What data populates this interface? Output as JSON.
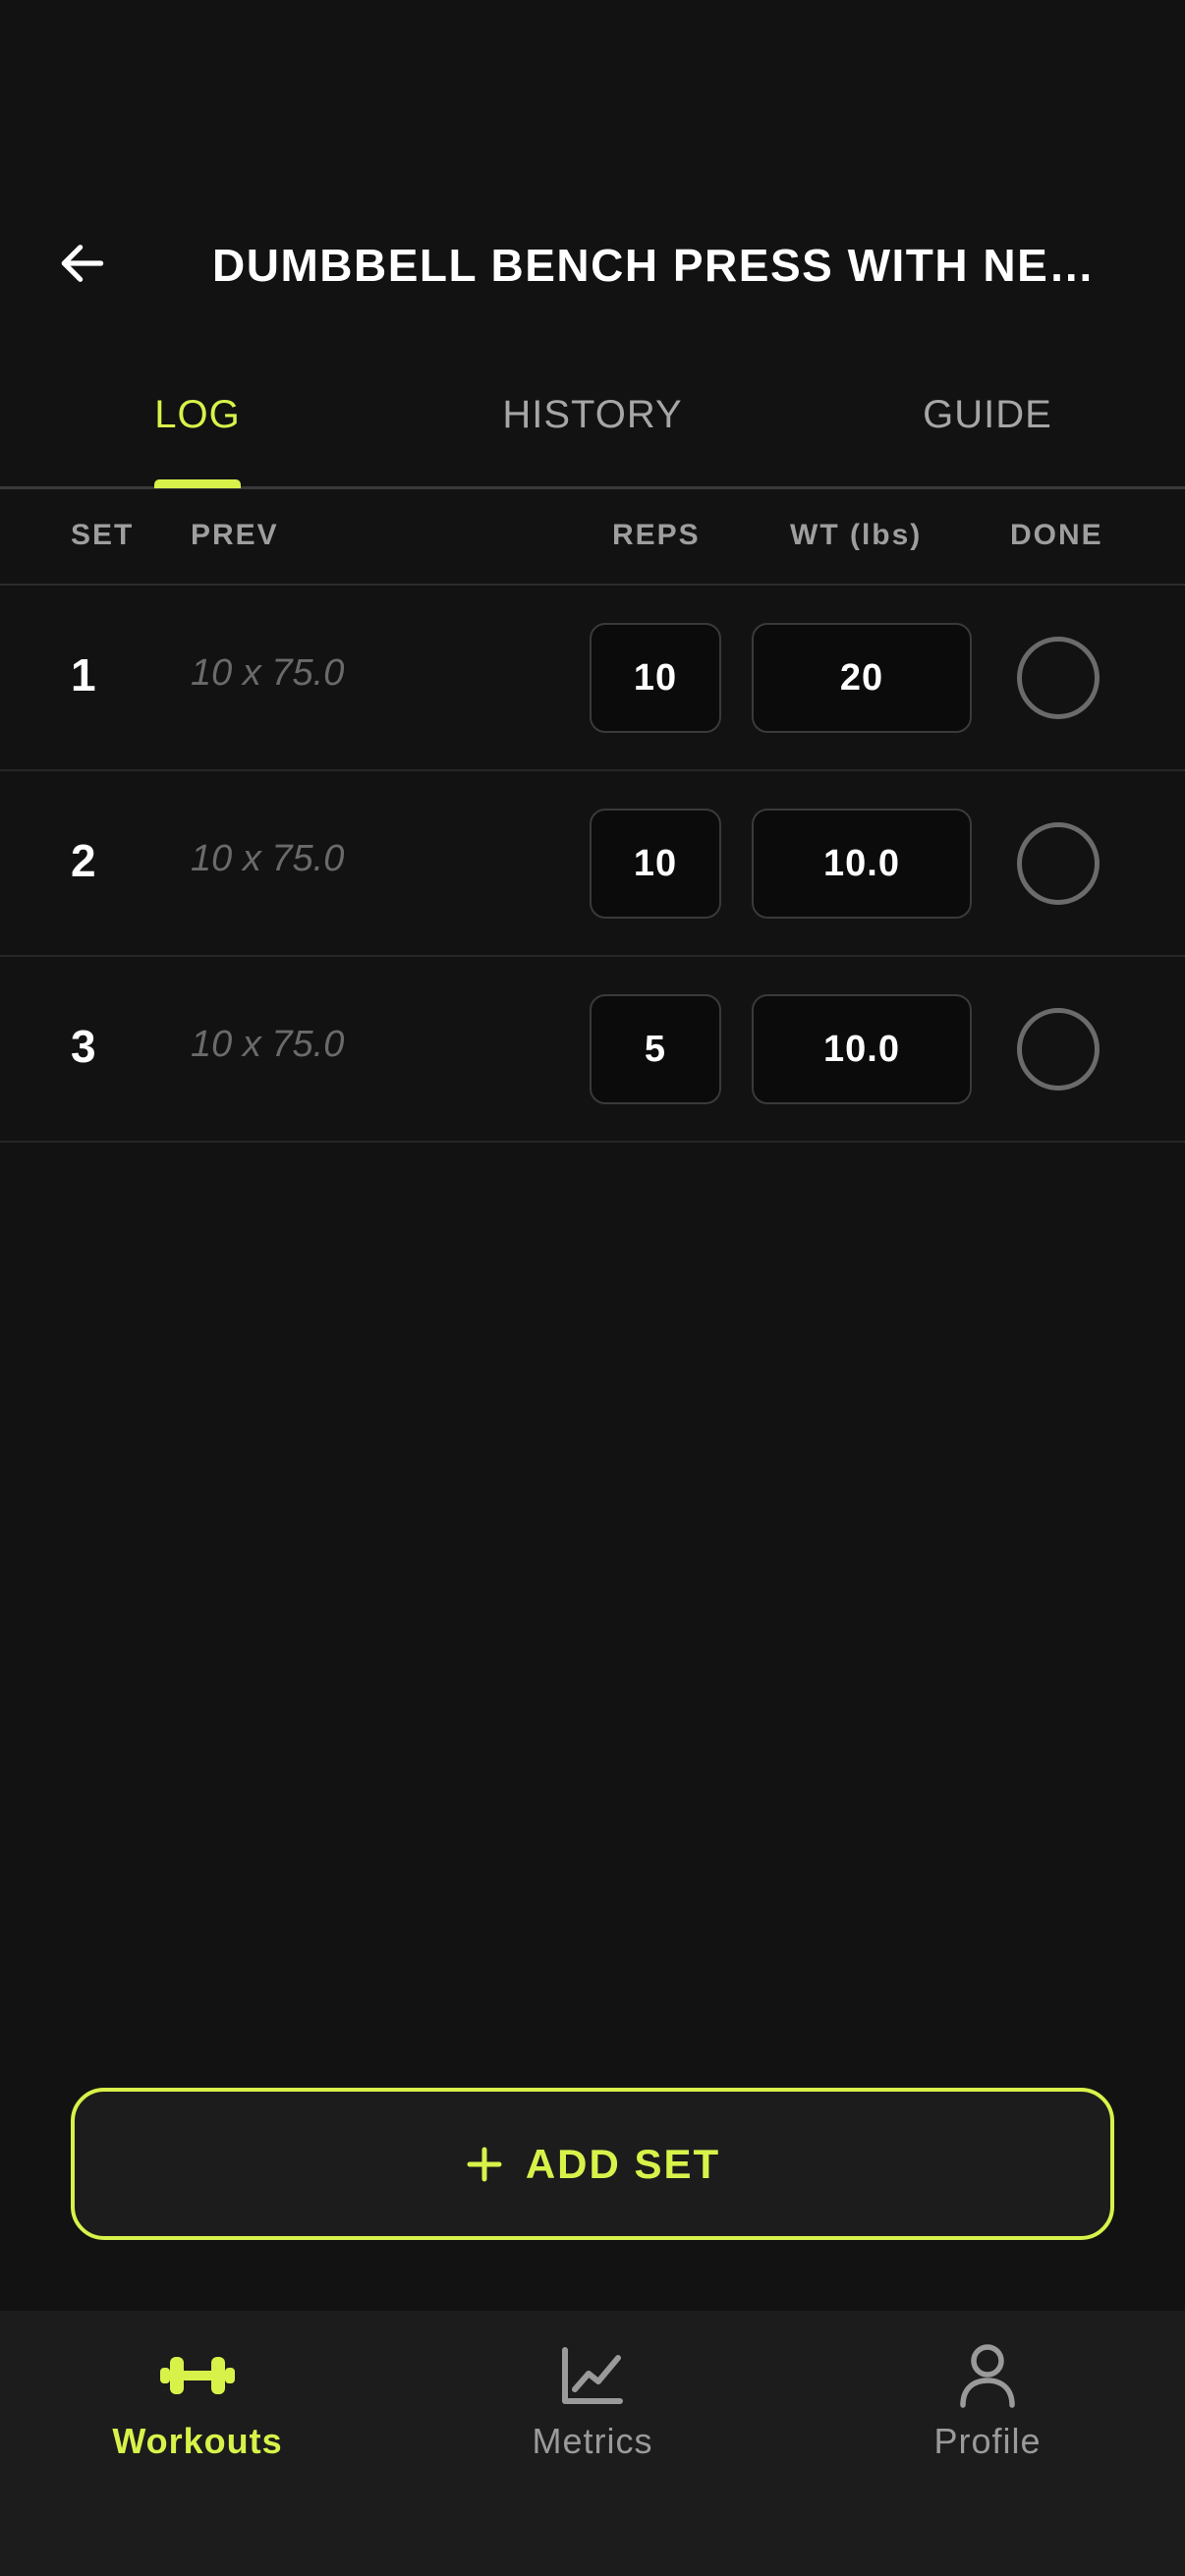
{
  "header": {
    "title": "DUMBBELL BENCH PRESS WITH NE…"
  },
  "tabs": [
    {
      "label": "LOG",
      "active": true
    },
    {
      "label": "HISTORY",
      "active": false
    },
    {
      "label": "GUIDE",
      "active": false
    }
  ],
  "columns": {
    "set": "SET",
    "prev": "PREV",
    "reps": "REPS",
    "wt": "WT (lbs)",
    "done": "DONE"
  },
  "sets": [
    {
      "set": "1",
      "prev": "10 x 75.0",
      "reps": "10",
      "wt": "20",
      "done": false
    },
    {
      "set": "2",
      "prev": "10 x 75.0",
      "reps": "10",
      "wt": "10.0",
      "done": false
    },
    {
      "set": "3",
      "prev": "10 x 75.0",
      "reps": "5",
      "wt": "10.0",
      "done": false
    }
  ],
  "add_set": {
    "icon": "plus-icon",
    "label": "ADD SET"
  },
  "nav": [
    {
      "label": "Workouts",
      "icon": "dumbbell-icon",
      "active": true
    },
    {
      "label": "Metrics",
      "icon": "chart-icon",
      "active": false
    },
    {
      "label": "Profile",
      "icon": "person-icon",
      "active": false
    }
  ],
  "colors": {
    "accent": "#d9f24a",
    "background": "#121212",
    "surface": "#1c1c1c",
    "muted_text": "#9e9e9e"
  }
}
